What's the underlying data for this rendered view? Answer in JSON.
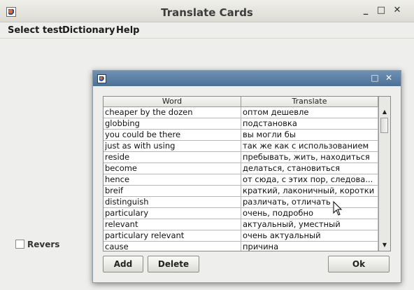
{
  "main_window": {
    "title": "Translate Cards",
    "controls": {
      "minimize": "_",
      "maximize": "□",
      "close": "✕"
    },
    "menu": [
      "Select test",
      "Dictionary",
      "Help"
    ],
    "revers_label": "Revers",
    "revers_checked": false
  },
  "dialog": {
    "controls": {
      "maximize": "□",
      "close": "✕"
    },
    "table": {
      "columns": [
        "Word",
        "Translate"
      ],
      "rows": [
        [
          "cheaper by the dozen",
          "оптом дешевле"
        ],
        [
          "globbing",
          "подстановка"
        ],
        [
          "you could be there",
          "вы могли бы"
        ],
        [
          "just as with using",
          "так же как с использованием"
        ],
        [
          "reside",
          "пребывать, жить, находиться"
        ],
        [
          "become",
          "делаться, становиться"
        ],
        [
          "hence",
          "от сюда, с этих пор, следова..."
        ],
        [
          "breif",
          "краткий, лаконичный, коротки"
        ],
        [
          "distinguish",
          "различать, отличать"
        ],
        [
          "particulary",
          "очень, подробно"
        ],
        [
          "relevant",
          "актуальный, уместный"
        ],
        [
          "particulary relevant",
          "очень актуальный"
        ],
        [
          "cause",
          "причина"
        ]
      ]
    },
    "buttons": {
      "add": "Add",
      "delete": "Delete",
      "ok": "Ok"
    }
  }
}
